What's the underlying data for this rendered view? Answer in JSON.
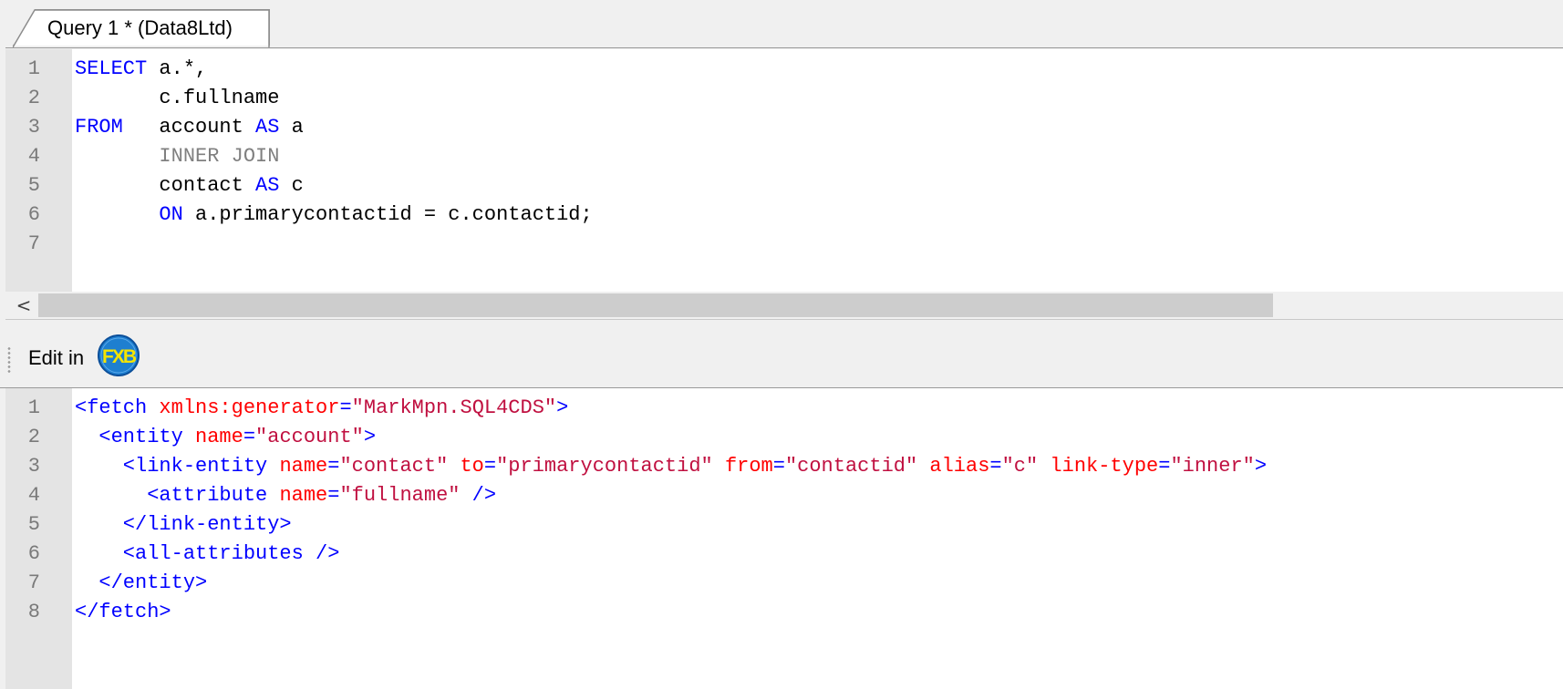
{
  "tab": {
    "title": "Query 1 * (Data8Ltd)"
  },
  "sql_editor": {
    "lines": [
      {
        "num": "1",
        "tokens": [
          {
            "t": "SELECT",
            "c": "kw"
          },
          {
            "t": " a.*,",
            "c": "pl"
          }
        ]
      },
      {
        "num": "2",
        "tokens": [
          {
            "t": "       c.fullname",
            "c": "pl"
          }
        ]
      },
      {
        "num": "3",
        "tokens": [
          {
            "t": "FROM",
            "c": "kw"
          },
          {
            "t": "   account ",
            "c": "pl"
          },
          {
            "t": "AS",
            "c": "kw"
          },
          {
            "t": " a",
            "c": "pl"
          }
        ]
      },
      {
        "num": "4",
        "tokens": [
          {
            "t": "       INNER JOIN",
            "c": "kg"
          }
        ]
      },
      {
        "num": "5",
        "tokens": [
          {
            "t": "       contact ",
            "c": "pl"
          },
          {
            "t": "AS",
            "c": "kw"
          },
          {
            "t": " c",
            "c": "pl"
          }
        ]
      },
      {
        "num": "6",
        "tokens": [
          {
            "t": "       ",
            "c": "pl"
          },
          {
            "t": "ON",
            "c": "kw"
          },
          {
            "t": " a.primarycontactid = c.contactid;",
            "c": "pl"
          }
        ]
      },
      {
        "num": "7",
        "tokens": []
      }
    ]
  },
  "scrollbar": {
    "left_arrow": "<"
  },
  "toolbar": {
    "edit_label": "Edit in",
    "fxb_text": "FXB"
  },
  "xml_editor": {
    "lines": [
      {
        "num": "1",
        "tokens": [
          {
            "t": "<fetch ",
            "c": "tg"
          },
          {
            "t": "xmlns:generator",
            "c": "at"
          },
          {
            "t": "=",
            "c": "tg"
          },
          {
            "t": "\"MarkMpn.SQL4CDS\"",
            "c": "st"
          },
          {
            "t": ">",
            "c": "tg"
          }
        ]
      },
      {
        "num": "2",
        "tokens": [
          {
            "t": "  <entity ",
            "c": "tg"
          },
          {
            "t": "name",
            "c": "at"
          },
          {
            "t": "=",
            "c": "tg"
          },
          {
            "t": "\"account\"",
            "c": "st"
          },
          {
            "t": ">",
            "c": "tg"
          }
        ]
      },
      {
        "num": "3",
        "tokens": [
          {
            "t": "    <link-entity ",
            "c": "tg"
          },
          {
            "t": "name",
            "c": "at"
          },
          {
            "t": "=",
            "c": "tg"
          },
          {
            "t": "\"contact\"",
            "c": "st"
          },
          {
            "t": " ",
            "c": "tg"
          },
          {
            "t": "to",
            "c": "at"
          },
          {
            "t": "=",
            "c": "tg"
          },
          {
            "t": "\"primarycontactid\"",
            "c": "st"
          },
          {
            "t": " ",
            "c": "tg"
          },
          {
            "t": "from",
            "c": "at"
          },
          {
            "t": "=",
            "c": "tg"
          },
          {
            "t": "\"contactid\"",
            "c": "st"
          },
          {
            "t": " ",
            "c": "tg"
          },
          {
            "t": "alias",
            "c": "at"
          },
          {
            "t": "=",
            "c": "tg"
          },
          {
            "t": "\"c\"",
            "c": "st"
          },
          {
            "t": " ",
            "c": "tg"
          },
          {
            "t": "link-type",
            "c": "at"
          },
          {
            "t": "=",
            "c": "tg"
          },
          {
            "t": "\"inner\"",
            "c": "st"
          },
          {
            "t": ">",
            "c": "tg"
          }
        ]
      },
      {
        "num": "4",
        "tokens": [
          {
            "t": "      <attribute ",
            "c": "tg"
          },
          {
            "t": "name",
            "c": "at"
          },
          {
            "t": "=",
            "c": "tg"
          },
          {
            "t": "\"fullname\"",
            "c": "st"
          },
          {
            "t": " />",
            "c": "tg"
          }
        ]
      },
      {
        "num": "5",
        "tokens": [
          {
            "t": "    </link-entity>",
            "c": "tg"
          }
        ]
      },
      {
        "num": "6",
        "tokens": [
          {
            "t": "    <all-attributes />",
            "c": "tg"
          }
        ]
      },
      {
        "num": "7",
        "tokens": [
          {
            "t": "  </entity>",
            "c": "tg"
          }
        ]
      },
      {
        "num": "8",
        "tokens": [
          {
            "t": "</fetch>",
            "c": "tg"
          }
        ]
      }
    ]
  },
  "colors": {
    "keyword": "#0000ff",
    "join_keyword": "#808080",
    "xml_tag": "#0000ff",
    "xml_attribute": "#ff0000",
    "xml_string": "#c01040",
    "gutter_bg": "#e4e4e4",
    "fxb_icon_bg": "#1e7fd0",
    "fxb_icon_text": "#f5e400"
  }
}
